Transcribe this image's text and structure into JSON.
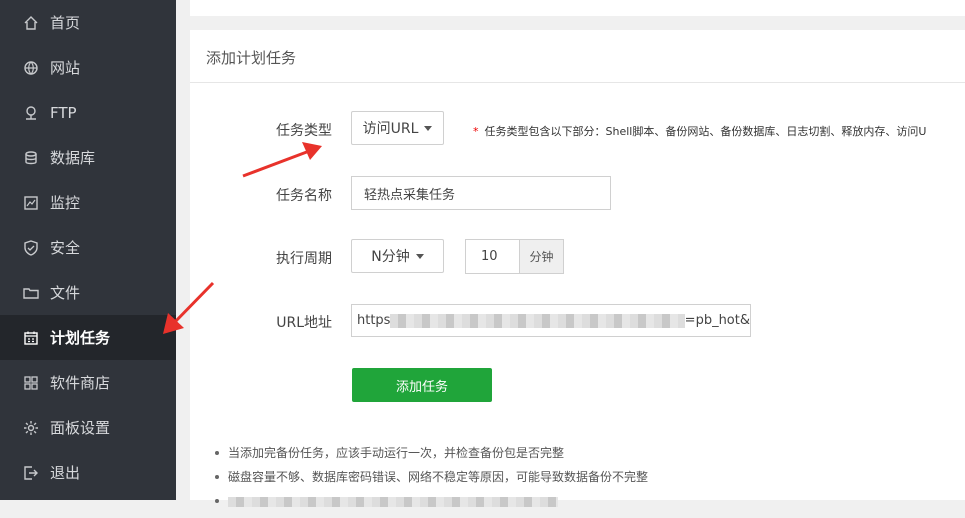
{
  "sidebar": {
    "items": [
      {
        "label": "首页",
        "icon": "home-icon"
      },
      {
        "label": "网站",
        "icon": "globe-icon"
      },
      {
        "label": "FTP",
        "icon": "ftp-icon"
      },
      {
        "label": "数据库",
        "icon": "database-icon"
      },
      {
        "label": "监控",
        "icon": "monitor-icon"
      },
      {
        "label": "安全",
        "icon": "shield-icon"
      },
      {
        "label": "文件",
        "icon": "folder-icon"
      },
      {
        "label": "计划任务",
        "icon": "calendar-icon",
        "active": true
      },
      {
        "label": "软件商店",
        "icon": "grid-icon"
      },
      {
        "label": "面板设置",
        "icon": "gear-icon"
      },
      {
        "label": "退出",
        "icon": "logout-icon"
      }
    ]
  },
  "card": {
    "title": "添加计划任务"
  },
  "form": {
    "task_type_label": "任务类型",
    "task_type_value": "访问URL",
    "task_type_hint_star": "*",
    "task_type_hint": "任务类型包含以下部分：Shell脚本、备份网站、备份数据库、日志切割、释放内存、访问U",
    "task_name_label": "任务名称",
    "task_name_value": "轻热点采集任务",
    "period_label": "执行周期",
    "period_value": "N分钟",
    "period_number": "10",
    "period_unit": "分钟",
    "url_label": "URL地址",
    "url_prefix": "https",
    "url_suffix": "=pb_hot&",
    "submit_label": "添加任务"
  },
  "notes": [
    "当添加完备份任务，应该手动运行一次，并检查备份包是否完整",
    "磁盘容量不够、数据库密码错误、网络不稳定等原因，可能导致数据备份不完整"
  ],
  "colors": {
    "sidebar_bg": "#30343b",
    "sidebar_active": "#23262b",
    "primary_button": "#20a53a",
    "annotation_arrow": "#e8322b"
  }
}
